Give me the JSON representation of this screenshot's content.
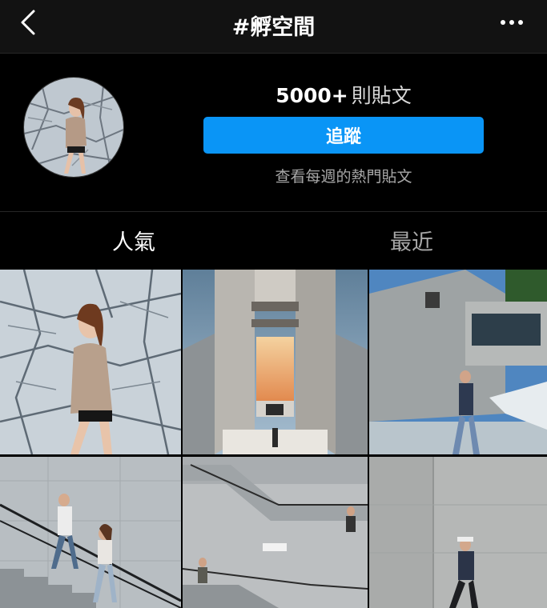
{
  "header": {
    "title": "#孵空間",
    "back_icon": "chevron-left-icon",
    "more_icon": "more-horizontal-icon"
  },
  "profile": {
    "post_count": "5000+",
    "post_count_unit": "則貼文",
    "follow_label": "追蹤",
    "weekly_top_label": "查看每週的熱門貼文"
  },
  "tabs": [
    {
      "label": "人氣",
      "active": true
    },
    {
      "label": "最近",
      "active": false
    }
  ],
  "grid": {
    "tiles": [
      {
        "subject": "woman-posing-marble-wall"
      },
      {
        "subject": "concrete-tower-sunset"
      },
      {
        "subject": "man-concrete-building-pool"
      },
      {
        "subject": "couple-on-concrete-stairs"
      },
      {
        "subject": "stairs-wall-people"
      },
      {
        "subject": "man-leaning-concrete-wall"
      }
    ]
  },
  "colors": {
    "background": "#000000",
    "header_background": "#121212",
    "follow_button": "#0a95f6",
    "muted_text": "#a8a8a8"
  }
}
